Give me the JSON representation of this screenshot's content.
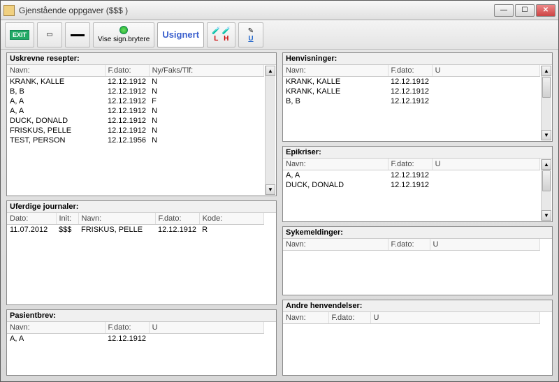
{
  "window": {
    "title": "Gjenstående oppgaver ($$$ )"
  },
  "toolbar": {
    "exit": "EXIT",
    "vise": "Vise sign.brytere",
    "usignert": "Usignert",
    "l": "L",
    "h": "H",
    "u": "U"
  },
  "panels": {
    "uskrevne": {
      "title": "Uskrevne resepter:",
      "headers": {
        "navn": "Navn:",
        "fdato": "F.dato:",
        "nyfakstlf": "Ny/Faks/Tlf:"
      },
      "rows": [
        {
          "navn": "KRANK, KALLE",
          "fdato": "12.12.1912",
          "ny": "N"
        },
        {
          "navn": "B, B",
          "fdato": "12.12.1912",
          "ny": "N"
        },
        {
          "navn": "A, A",
          "fdato": "12.12.1912",
          "ny": "F"
        },
        {
          "navn": "A, A",
          "fdato": "12.12.1912",
          "ny": "N"
        },
        {
          "navn": "DUCK, DONALD",
          "fdato": "12.12.1912",
          "ny": "N"
        },
        {
          "navn": "FRISKUS, PELLE",
          "fdato": "12.12.1912",
          "ny": "N"
        },
        {
          "navn": "TEST, PERSON",
          "fdato": "12.12.1956",
          "ny": "N"
        }
      ]
    },
    "uferdige": {
      "title": "Uferdige journaler:",
      "headers": {
        "dato": "Dato:",
        "init": "Init:",
        "navn": "Navn:",
        "fdato": "F.dato:",
        "kode": "Kode:"
      },
      "rows": [
        {
          "dato": "11.07.2012",
          "init": "$$$",
          "navn": "FRISKUS, PELLE",
          "fdato": "12.12.1912",
          "kode": "R"
        }
      ]
    },
    "pasientbrev": {
      "title": "Pasientbrev:",
      "headers": {
        "navn": "Navn:",
        "fdato": "F.dato:",
        "u": "U"
      },
      "rows": [
        {
          "navn": "A, A",
          "fdato": "12.12.1912",
          "u": ""
        }
      ]
    },
    "henvisninger": {
      "title": "Henvisninger:",
      "headers": {
        "navn": "Navn:",
        "fdato": "F.dato:",
        "u": "U"
      },
      "rows": [
        {
          "navn": "KRANK, KALLE",
          "fdato": "12.12.1912",
          "u": ""
        },
        {
          "navn": "KRANK, KALLE",
          "fdato": "12.12.1912",
          "u": ""
        },
        {
          "navn": "B, B",
          "fdato": "12.12.1912",
          "u": ""
        }
      ]
    },
    "epikriser": {
      "title": "Epikriser:",
      "headers": {
        "navn": "Navn:",
        "fdato": "F.dato:",
        "u": "U"
      },
      "rows": [
        {
          "navn": "A, A",
          "fdato": "12.12.1912",
          "u": ""
        },
        {
          "navn": "DUCK, DONALD",
          "fdato": "12.12.1912",
          "u": ""
        }
      ]
    },
    "sykemeldinger": {
      "title": "Sykemeldinger:",
      "headers": {
        "navn": "Navn:",
        "fdato": "F.dato:",
        "u": "U"
      },
      "rows": []
    },
    "andre": {
      "title": "Andre henvendelser:",
      "headers": {
        "navn": "Navn:",
        "fdato": "F.dato:",
        "u": "U"
      },
      "rows": []
    }
  }
}
